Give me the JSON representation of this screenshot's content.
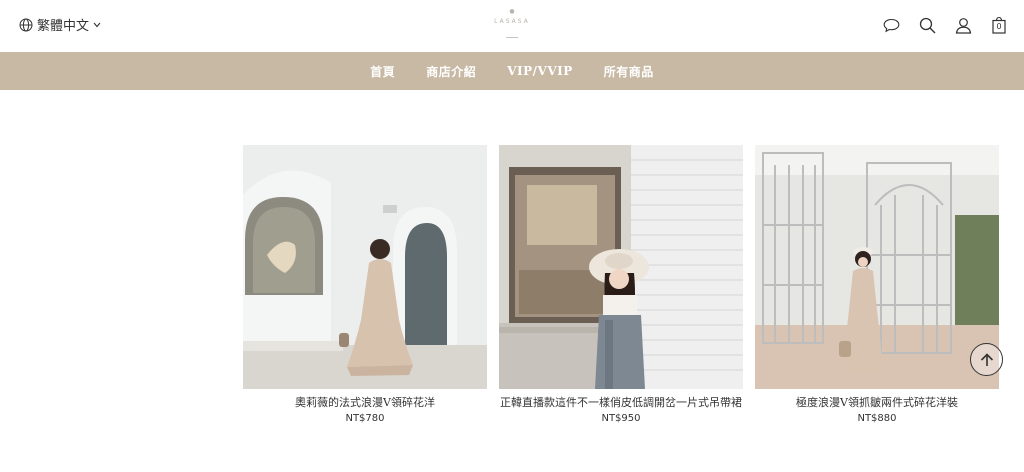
{
  "header": {
    "language_label": "繁體中文",
    "logo_text": "LASASA",
    "cart_count": "0"
  },
  "nav": {
    "items": [
      {
        "label": "首頁"
      },
      {
        "label": "商店介紹"
      },
      {
        "label": "VIP/VVIP"
      },
      {
        "label": "所有商品"
      }
    ]
  },
  "products": [
    {
      "name": "奧莉薇的法式浪漫V領碎花洋",
      "price": "NT$780"
    },
    {
      "name": "正韓直播款這件不一樣俏皮低調開岔一片式吊帶裙",
      "price": "NT$950"
    },
    {
      "name": "極度浪漫V領抓皺兩件式碎花洋裝",
      "price": "NT$880"
    }
  ],
  "colors": {
    "nav_background": "#c8b9a4",
    "nav_text": "#ffffff"
  }
}
